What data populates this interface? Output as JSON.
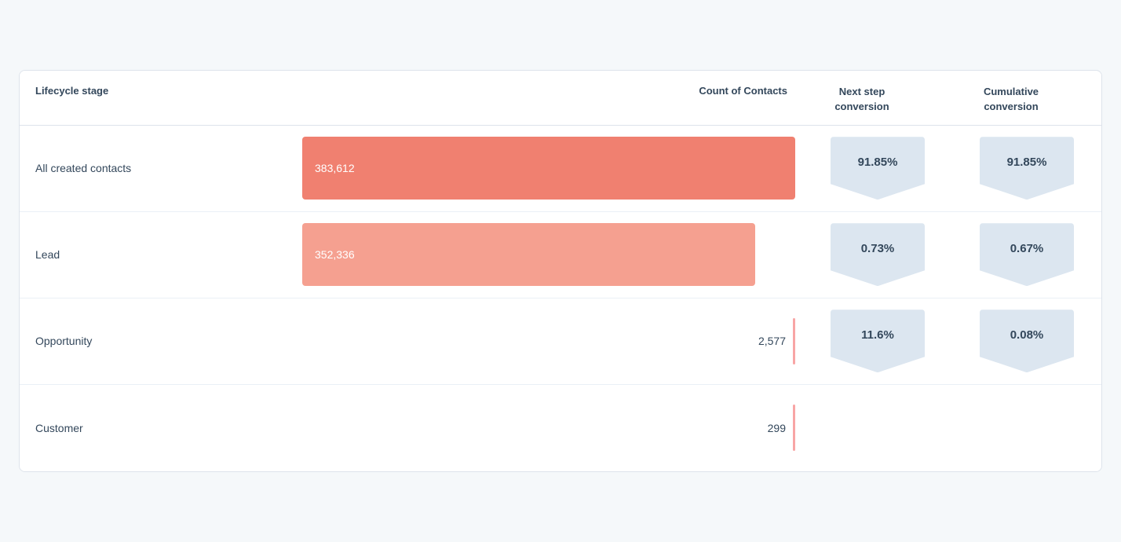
{
  "headers": {
    "lifecycle_stage": "Lifecycle stage",
    "count_of_contacts": "Count of Contacts",
    "next_step_conversion": "Next step\nconversion",
    "cumulative_conversion": "Cumulative\nconversion"
  },
  "rows": [
    {
      "id": "all-created-contacts",
      "label": "All created contacts",
      "count_display": "383,612",
      "bar_width_pct": 100,
      "bar_color": "#f08070",
      "bar_color_light": "#f59080",
      "count_in_bar": true,
      "next_step": "91.85%",
      "cumulative": "91.85%",
      "has_conversion": true
    },
    {
      "id": "lead",
      "label": "Lead",
      "count_display": "352,336",
      "bar_width_pct": 91.8,
      "bar_color": "#f5a090",
      "bar_color_light": "#f5a090",
      "count_in_bar": true,
      "next_step": "0.73%",
      "cumulative": "0.67%",
      "has_conversion": true
    },
    {
      "id": "opportunity",
      "label": "Opportunity",
      "count_display": "2,577",
      "bar_width_pct": 0,
      "bar_color": "",
      "count_in_bar": false,
      "next_step": "11.6%",
      "cumulative": "0.08%",
      "has_conversion": true,
      "small_bar": true
    },
    {
      "id": "customer",
      "label": "Customer",
      "count_display": "299",
      "bar_width_pct": 0,
      "bar_color": "",
      "count_in_bar": false,
      "next_step": "",
      "cumulative": "",
      "has_conversion": false,
      "small_bar": true
    }
  ]
}
